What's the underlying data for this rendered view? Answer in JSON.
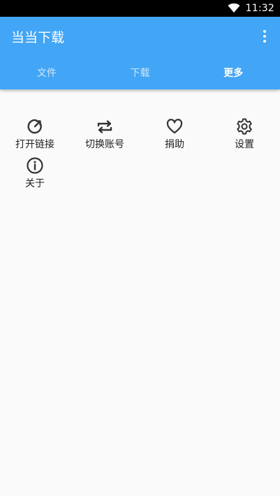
{
  "status_bar": {
    "time": "11:32",
    "wifi_icon": "wifi-icon"
  },
  "app_bar": {
    "title": "当当下载",
    "menu_icon": "more-vert-icon",
    "background_color": "#42a5f5"
  },
  "tabs": [
    {
      "label": "文件",
      "active": false
    },
    {
      "label": "下载",
      "active": false
    },
    {
      "label": "更多",
      "active": true
    }
  ],
  "grid": {
    "items": [
      {
        "label": "打开链接",
        "icon": "open-link-icon"
      },
      {
        "label": "切换账号",
        "icon": "switch-account-icon"
      },
      {
        "label": "捐助",
        "icon": "heart-icon"
      },
      {
        "label": "设置",
        "icon": "gear-icon"
      },
      {
        "label": "关于",
        "icon": "info-icon"
      }
    ]
  }
}
